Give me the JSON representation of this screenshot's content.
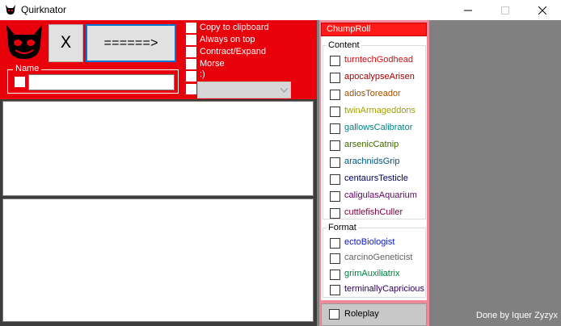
{
  "window": {
    "title": "Quirknator"
  },
  "toolbar": {
    "clear_label": "X",
    "convert_label": "======>"
  },
  "name_group": {
    "label": "Name",
    "value": ""
  },
  "options": [
    {
      "label": "Copy to clipboard"
    },
    {
      "label": "Always on top"
    },
    {
      "label": "Contract/Expand"
    },
    {
      "label": "Morse"
    },
    {
      "label": ":)"
    }
  ],
  "dropdown": {
    "value": ""
  },
  "chumproll": {
    "title": "ChumpRoll",
    "content_label": "Content",
    "content_items": [
      {
        "label": "turntechGodhead",
        "color": "#e00707"
      },
      {
        "label": "apocalypseArisen",
        "color": "#a10000"
      },
      {
        "label": "adiosToreador",
        "color": "#a15000"
      },
      {
        "label": "twinArmageddons",
        "color": "#a1a100"
      },
      {
        "label": "gallowsCalibrator",
        "color": "#008282"
      },
      {
        "label": "arsenicCatnip",
        "color": "#416600"
      },
      {
        "label": "arachnidsGrip",
        "color": "#005682"
      },
      {
        "label": "centaursTesticle",
        "color": "#000056"
      },
      {
        "label": "caligulasAquarium",
        "color": "#6a006a"
      },
      {
        "label": "cuttlefishCuller",
        "color": "#77003c"
      }
    ],
    "format_label": "Format",
    "format_items": [
      {
        "label": "ectoBiologist",
        "color": "#0715cd"
      },
      {
        "label": "carcinoGeneticist",
        "color": "#626262"
      },
      {
        "label": "grimAuxiliatrix",
        "color": "#008141"
      },
      {
        "label": "terminallyCapricious",
        "color": "#2b0057"
      }
    ],
    "roleplay_label": "Roleplay"
  },
  "footer": {
    "credit": "Done by Iquer Zyzyx"
  }
}
